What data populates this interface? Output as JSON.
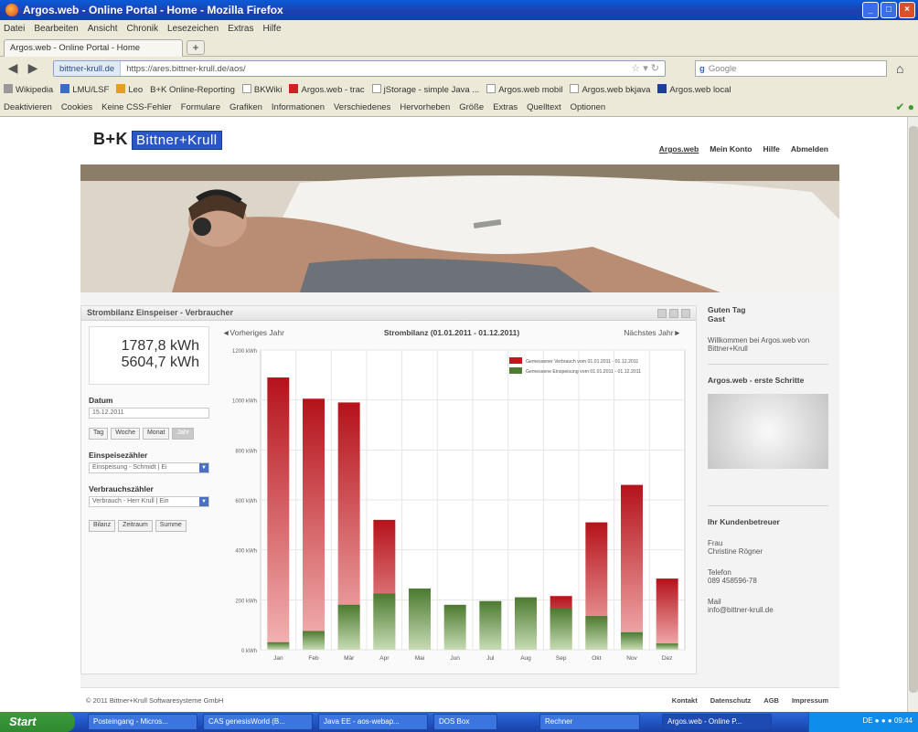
{
  "window": {
    "title": "Argos.web - Online Portal - Home - Mozilla Firefox"
  },
  "menu": [
    "Datei",
    "Bearbeiten",
    "Ansicht",
    "Chronik",
    "Lesezeichen",
    "Extras",
    "Hilfe"
  ],
  "tab": {
    "label": "Argos.web - Online Portal - Home",
    "new_tab": "+"
  },
  "nav": {
    "site": "bittner-krull.de",
    "url": "https://ares.bittner-krull.de/aos/",
    "search_placeholder": "Google"
  },
  "bookmarks": [
    "Wikipedia",
    "LMU/LSF",
    "Leo",
    "B+K Online-Reporting",
    "BKWiki",
    "Argos.web - trac",
    "jStorage - simple Java ...",
    "Argos.web mobil",
    "Argos.web bkjava",
    "Argos.web local"
  ],
  "webdev": [
    "Deaktivieren",
    "Cookies",
    "Keine CSS-Fehler",
    "Formulare",
    "Grafiken",
    "Informationen",
    "Verschiedenes",
    "Hervorheben",
    "Größe",
    "Extras",
    "Quelltext",
    "Optionen"
  ],
  "site": {
    "logo_main": "B+K",
    "logo_sub": "Bittner+Krull",
    "topnav": [
      "Argos.web",
      "Mein Konto",
      "Hilfe",
      "Abmelden"
    ]
  },
  "widget": {
    "title": "Strombilanz Einspeiser - Verbraucher",
    "kwh1": "1787,8 kWh",
    "kwh2": "5604,7 kWh",
    "datum_label": "Datum",
    "datum_value": "15.12.2011",
    "range_buttons": [
      "Tag",
      "Woche",
      "Monat",
      "Jahr"
    ],
    "einspeise_label": "Einspeisezähler",
    "einspeise_value": "Einspeisung - Schmidt | Ei",
    "verbrauch_label": "Verbrauchszähler",
    "verbrauch_value": "Verbrauch - Herr Krull | Ein",
    "action_buttons": [
      "Bilanz",
      "Zeitraum",
      "Summe"
    ],
    "prev": "◄Vorheriges Jahr",
    "chart_title": "Strombilanz (01.01.2011 - 01.12.2011)",
    "next": "Nächstes Jahr►"
  },
  "chart_data": {
    "type": "bar",
    "categories": [
      "Jan",
      "Feb",
      "Mär",
      "Apr",
      "Mai",
      "Jun",
      "Jul",
      "Aug",
      "Sep",
      "Okt",
      "Nov",
      "Dez"
    ],
    "series": [
      {
        "name": "Gemessener Verbrauch vom 01.01.2011 - 01.12.2011",
        "color": "#c4161c",
        "values": [
          1090,
          1005,
          990,
          520,
          150,
          0,
          0,
          170,
          215,
          510,
          660,
          285
        ]
      },
      {
        "name": "Gemessene Einspeisung vom 01.01.2011 - 01.12.2011",
        "color": "#4e7a32",
        "values": [
          30,
          75,
          180,
          225,
          245,
          180,
          195,
          210,
          165,
          135,
          70,
          25
        ]
      }
    ],
    "ylim": [
      0,
      1200
    ],
    "yticks": [
      "0 kWh",
      "200 kWh",
      "400 kWh",
      "600 kWh",
      "800 kWh",
      "1000 kWh",
      "1200 kWh"
    ],
    "legend": "top-right",
    "grid": true
  },
  "sidebar": {
    "greeting": "Guten Tag",
    "user": "Gast",
    "welcome": "Willkommen bei Argos.web von Bittner+Krull",
    "first_steps": "Argos.web - erste Schritte",
    "contact_head": "Ihr Kundenbetreuer",
    "salutation": "Frau",
    "name": "Christine Rögner",
    "phone_label": "Telefon",
    "phone": "089 458596-78",
    "mail_label": "Mail",
    "mail": "info@bittner-krull.de"
  },
  "footer": {
    "copyright": "© 2011 Bittner+Krull Softwaresysteme GmbH",
    "links": [
      "Kontakt",
      "Datenschutz",
      "AGB",
      "Impressum"
    ]
  },
  "taskbar": {
    "start": "Start",
    "tasks": [
      "Posteingang - Micros...",
      "CAS genesisWorld (B...",
      "Java EE - aos-webap...",
      "DOS Box",
      "Rechner",
      "Argos.web - Online P..."
    ],
    "lang": "DE",
    "time": "09:44"
  }
}
